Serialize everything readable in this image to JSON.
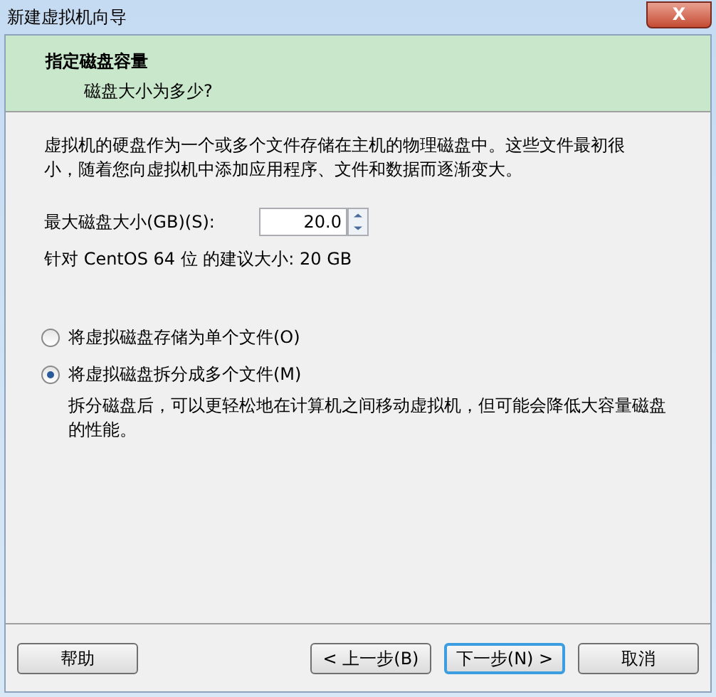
{
  "window": {
    "title": "新建虚拟机向导",
    "close": "X"
  },
  "header": {
    "title": "指定磁盘容量",
    "subtitle": "磁盘大小为多少?"
  },
  "intro": "虚拟机的硬盘作为一个或多个文件存储在主机的物理磁盘中。这些文件最初很小，随着您向虚拟机中添加应用程序、文件和数据而逐渐变大。",
  "size_field": {
    "label": "最大磁盘大小(GB)(S):",
    "value": "20.0"
  },
  "recommendation": "针对 CentOS 64 位 的建议大小: 20 GB",
  "options": [
    {
      "label": "将虚拟磁盘存储为单个文件(O)",
      "selected": false
    },
    {
      "label": "将虚拟磁盘拆分成多个文件(M)",
      "selected": true,
      "description": "拆分磁盘后，可以更轻松地在计算机之间移动虚拟机，但可能会降低大容量磁盘的性能。"
    }
  ],
  "buttons": [
    {
      "label": "帮助",
      "default": false
    },
    {
      "label": "< 上一步(B)",
      "default": false
    },
    {
      "label": "下一步(N) >",
      "default": true
    },
    {
      "label": "取消",
      "default": false
    }
  ]
}
